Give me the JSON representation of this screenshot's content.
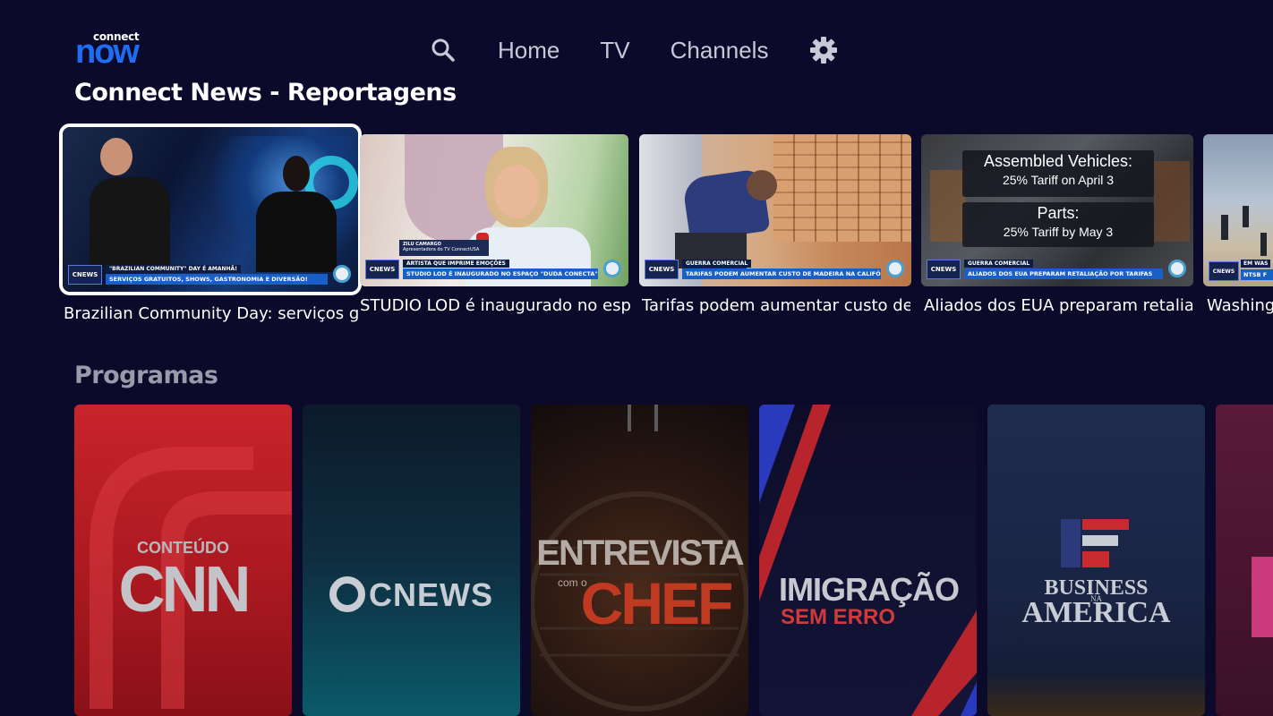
{
  "app": {
    "logo_small": "connect",
    "logo_big": "now"
  },
  "nav": {
    "search_icon": "search-icon",
    "items": [
      "Home",
      "TV",
      "Channels"
    ],
    "settings_icon": "gear-icon"
  },
  "sections": {
    "news_title": "Connect News - Reportagens",
    "programs_title": "Programas"
  },
  "news": [
    {
      "caption": "Brazilian Community Day: serviços g...",
      "tag": "\"BRAZILIAN COMMUNITY\" DAY É AMANHÃ!",
      "bar": "SERVIÇOS GRATUITOS, SHOWS, GASTRONOMIA E DIVERSÃO!"
    },
    {
      "caption": "STUDIO LOD é inaugurado no espa...",
      "name_tag": "ZILU CAMARGO",
      "name_sub": "Apresentadora do TV ConnectUSA",
      "tag": "ARTISTA QUE IMPRIME EMOÇÕES",
      "bar": "STUDIO LOD É INAUGURADO NO ESPAÇO \"DUDA CONECTA\""
    },
    {
      "caption": "Tarifas podem aumentar custo de ...",
      "tag": "GUERRA COMERCIAL",
      "bar": "TARIFAS PODEM AUMENTAR CUSTO DE MADEIRA NA CALIFÓRNIA"
    },
    {
      "caption": "Aliados dos EUA preparam retaliaçã...",
      "box1_title": "Assembled Vehicles:",
      "box1_sub": "25% Tariff on April 3",
      "box2_title": "Parts:",
      "box2_sub": "25% Tariff by May 3",
      "tag": "GUERRA COMERCIAL",
      "bar": "ALIADOS DOS EUA PREPARAM RETALIAÇÃO POR TARIFAS"
    },
    {
      "caption": "Washingto",
      "tag": "EM WAS",
      "bar": "NTSB F"
    }
  ],
  "chip_label": "CNEWS",
  "programs": [
    {
      "line1": "CONTEÚDO",
      "line2": "CNN"
    },
    {
      "line1": "CNEWS"
    },
    {
      "line1": "ENTREVISTA",
      "line2": "com o",
      "line3": "CHEF"
    },
    {
      "line1": "IMIGRAÇÃO",
      "line2": "SEM ERRO"
    },
    {
      "line1": "BUSINESS",
      "line2": "NA",
      "line3": "AMERICA"
    }
  ],
  "colors": {
    "background": "#0c0a2a",
    "brand_blue": "#1f6df2",
    "nav_text": "#c9c8d6",
    "muted_title": "#9b9aab"
  }
}
